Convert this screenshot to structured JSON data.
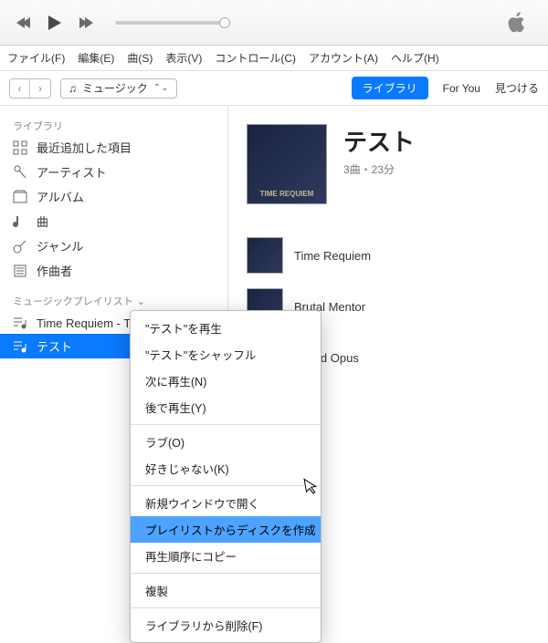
{
  "menubar": [
    "ファイル(F)",
    "編集(E)",
    "曲(S)",
    "表示(V)",
    "コントロール(C)",
    "アカウント(A)",
    "ヘルプ(H)"
  ],
  "media_selector": "ミュージック",
  "tab_library": "ライブラリ",
  "tab_foryou": "For You",
  "tab_browse": "見つける",
  "sidebar": {
    "library_label": "ライブラリ",
    "items": [
      {
        "label": "最近追加した項目"
      },
      {
        "label": "アーティスト"
      },
      {
        "label": "アルバム"
      },
      {
        "label": "曲"
      },
      {
        "label": "ジャンル"
      },
      {
        "label": "作曲者"
      }
    ],
    "playlists_label": "ミュージックプレイリスト",
    "playlists": [
      {
        "label": "Time Requiem - Time Req..."
      },
      {
        "label": "テスト"
      }
    ]
  },
  "playlist": {
    "title": "テスト",
    "meta": "3曲・23分",
    "tracks": [
      {
        "name": "Time Requiem"
      },
      {
        "name": "Brutal Mentor"
      },
      {
        "name": "Grand Opus"
      }
    ],
    "art_text": "TIME REQUIEM"
  },
  "context_menu": {
    "items": [
      "\"テスト\"を再生",
      "\"テスト\"をシャッフル",
      "次に再生(N)",
      "後で再生(Y)",
      "-",
      "ラブ(O)",
      "好きじゃない(K)",
      "-",
      "新規ウインドウで開く",
      "プレイリストからディスクを作成",
      "再生順序にコピー",
      "-",
      "複製",
      "-",
      "ライブラリから削除(F)"
    ],
    "highlighted_index": 9
  }
}
